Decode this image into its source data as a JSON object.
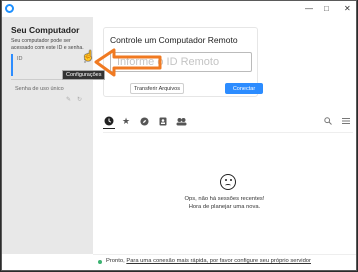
{
  "sidebar": {
    "title": "Seu Computador",
    "description": "Seu computador pode ser acessado com este ID e senha.",
    "id_label": "ID",
    "password_label": "Senha de uso único"
  },
  "tooltip": "Configurações",
  "remote": {
    "title": "Controle um Computador Remoto",
    "placeholder": "Informe o ID Remoto",
    "transfer_label": "Transferir Arquivos",
    "connect_label": "Conectar"
  },
  "tabs": [
    {
      "name": "recent",
      "icon": "clock-icon"
    },
    {
      "name": "favorites",
      "icon": "star-icon"
    },
    {
      "name": "discovered",
      "icon": "compass-icon"
    },
    {
      "name": "address-book",
      "icon": "address-book-icon"
    },
    {
      "name": "group",
      "icon": "group-icon"
    }
  ],
  "empty": {
    "line1": "Ops, não há sessões recentes!",
    "line2": "Hora de planejar uma nova."
  },
  "status": {
    "text": "Pronto,",
    "link": "Para uma conexão mais rápida, por favor configure seu próprio servidor"
  },
  "colors": {
    "accent": "#2c8cff",
    "annotation_arrow": "#f07a22",
    "status_ok": "#3cb371"
  }
}
